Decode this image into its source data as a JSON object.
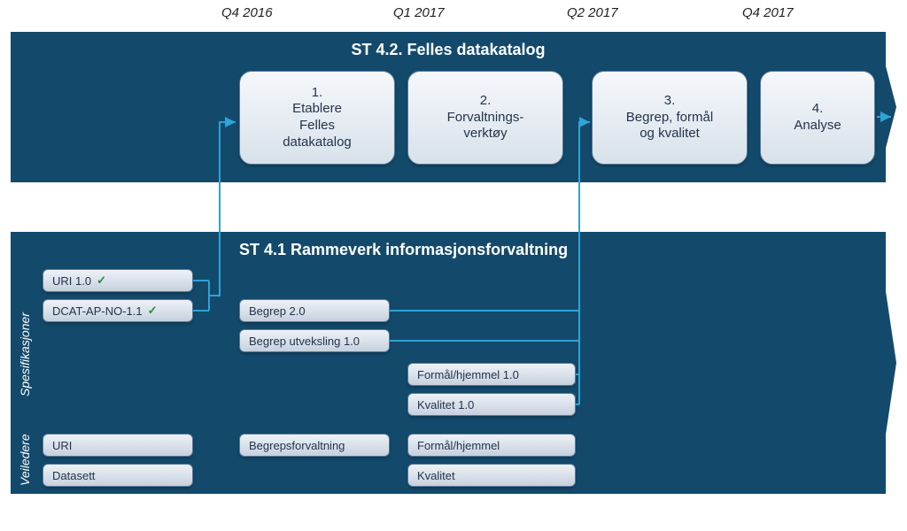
{
  "timeline": {
    "q4_2016": "Q4 2016",
    "q1_2017": "Q1 2017",
    "q2_2017": "Q2 2017",
    "q4_2017": "Q4 2017"
  },
  "panels": {
    "top_title": "ST 4.2. Felles datakatalog",
    "bottom_title": "ST 4.1 Rammeverk informasjonsforvaltning"
  },
  "phases": {
    "p1_num": "1.",
    "p1_l1": "Etablere",
    "p1_l2": "Felles",
    "p1_l3": "datakatalog",
    "p2_num": "2.",
    "p2_l1": "Forvaltnings-",
    "p2_l2": "verktøy",
    "p3_num": "3.",
    "p3_l1": "Begrep, formål",
    "p3_l2": "og kvalitet",
    "p4_num": "4.",
    "p4_l1": "Analyse"
  },
  "side_labels": {
    "specs": "Spesifikasjoner",
    "guides": "Veiledere"
  },
  "specs": {
    "uri10": "URI 1.0",
    "dcat": "DCAT-AP-NO-1.1",
    "begrep20": "Begrep 2.0",
    "begrep_exch": "Begrep utveksling 1.0",
    "formaal10": "Formål/hjemmel 1.0",
    "kvalitet10": "Kvalitet 1.0"
  },
  "guides": {
    "uri": "URI",
    "datasett": "Datasett",
    "begrepsforvaltning": "Begrepsforvaltning",
    "formaal": "Formål/hjemmel",
    "kvalitet": "Kvalitet"
  },
  "colors": {
    "panel": "#134a6c",
    "connector": "#2fa3d6"
  }
}
